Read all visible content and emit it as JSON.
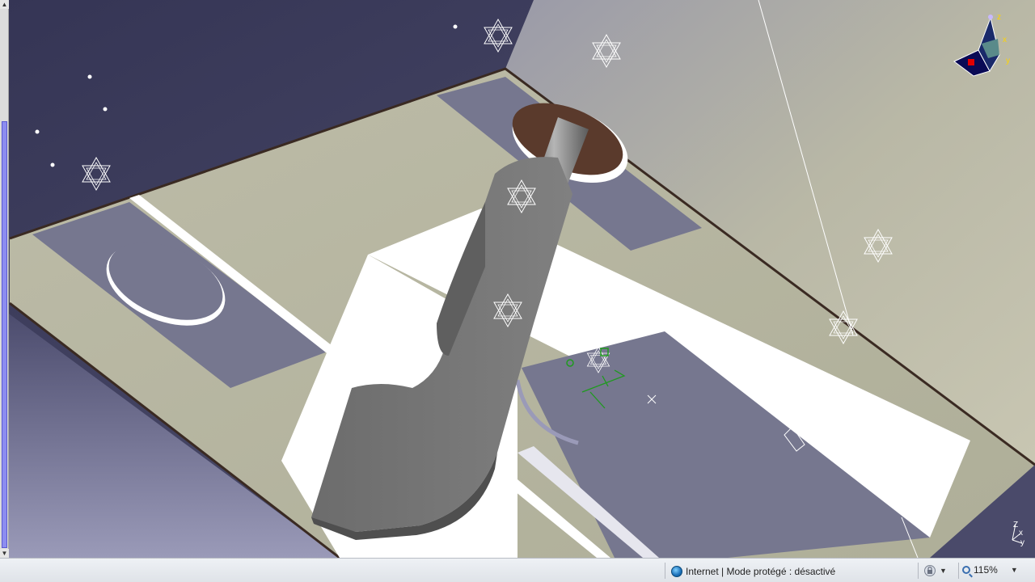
{
  "status_bar": {
    "zone_text": "Internet | Mode protégé : désactivé",
    "zoom_level": "115%",
    "zone_icon": "globe-icon",
    "protected_mode_icon": "security-lock-icon",
    "zoom_icon": "magnifier-icon"
  },
  "compass": {
    "axis_x": "x",
    "axis_y": "y",
    "axis_z": "z"
  },
  "axis_triad": {
    "axis_z": "Z",
    "axis_x": "x",
    "axis_y": "y"
  },
  "colors": {
    "background_top": "#3d3d5e",
    "plate": "#b9b8a3",
    "pocket": "#72738f",
    "part": "#7a7a7a",
    "scrollbar_thumb": "#8c8cf0",
    "constraint_green": "#1f9a1f"
  }
}
